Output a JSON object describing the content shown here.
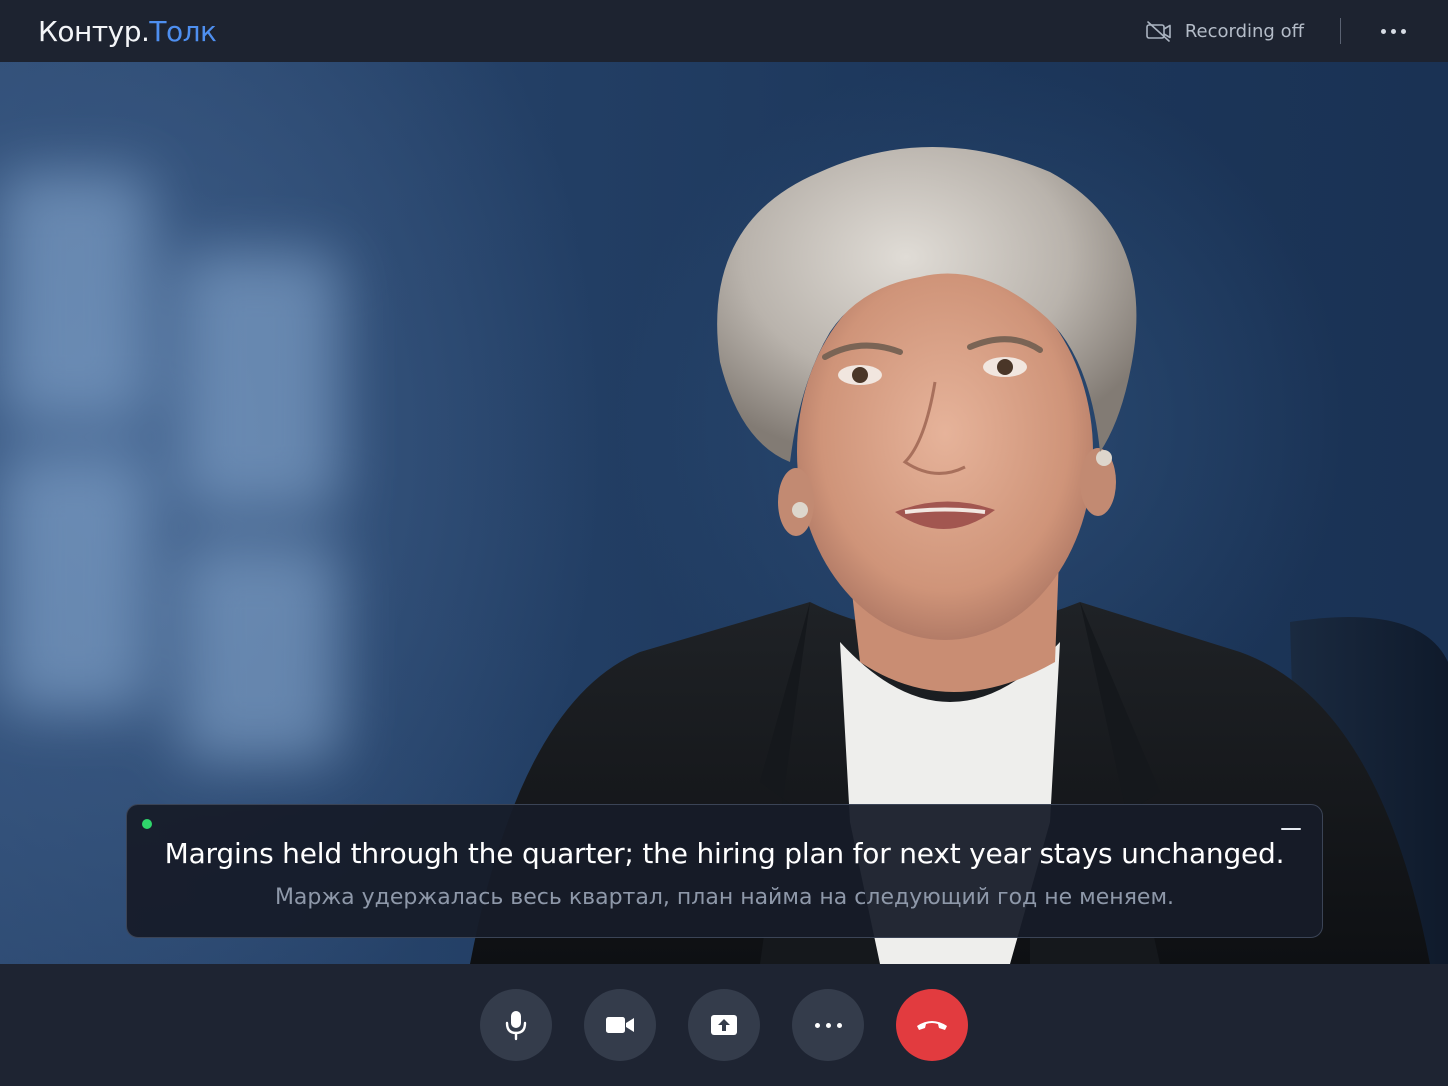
{
  "app": {
    "brand_main": "Контур",
    "brand_dot": ".",
    "brand_accent": "Толк"
  },
  "header": {
    "recording_label": "Recording off",
    "recording_icon": "camera-off-icon",
    "more_icon": "more-horizontal-icon"
  },
  "captions": {
    "live": true,
    "original": "Margins held through the quarter; the hiring plan for next year stays unchanged.",
    "translation": "Маржа удержалась весь квартал, план найма на следующий год не меняем.",
    "minimize_icon": "minimize-icon"
  },
  "controls": [
    {
      "name": "microphone-button",
      "icon": "microphone-icon"
    },
    {
      "name": "camera-button",
      "icon": "video-camera-icon"
    },
    {
      "name": "share-screen-button",
      "icon": "share-screen-icon"
    },
    {
      "name": "more-options-button",
      "icon": "more-horizontal-icon"
    },
    {
      "name": "end-call-button",
      "icon": "hang-up-icon"
    }
  ],
  "colors": {
    "accent": "#4e8ff0",
    "live_indicator": "#2fd66b",
    "end_call": "#e23b3f",
    "panel_bg": "#1d2330"
  }
}
